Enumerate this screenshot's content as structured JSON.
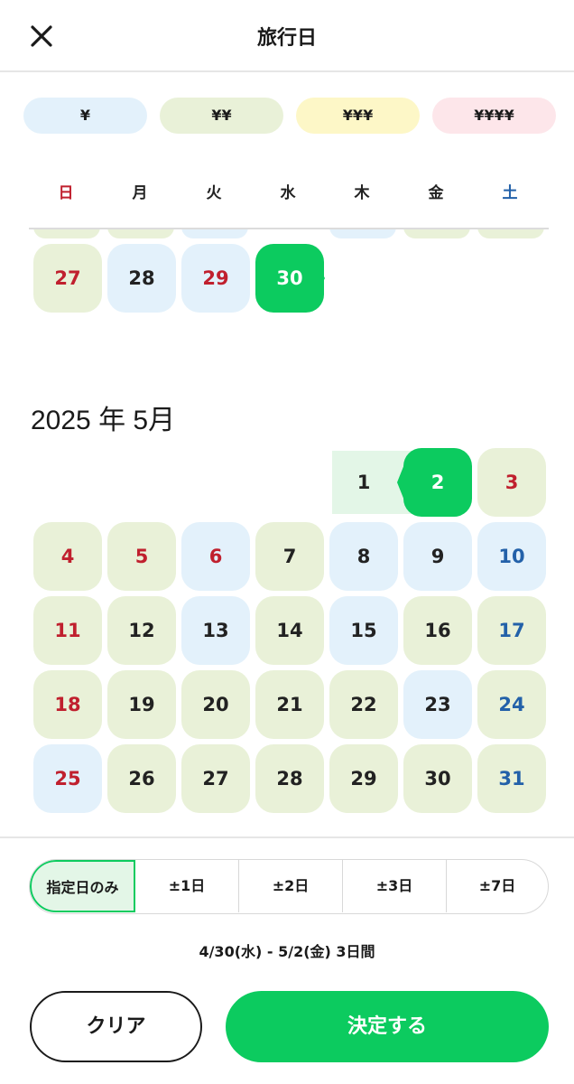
{
  "header": {
    "title": "旅行日",
    "close_icon": "close-icon"
  },
  "price_levels": [
    {
      "label": "¥",
      "color": "#e3f1fb"
    },
    {
      "label": "¥¥",
      "color": "#e9f1d8"
    },
    {
      "label": "¥¥¥",
      "color": "#fdf7c7"
    },
    {
      "label": "¥¥¥¥",
      "color": "#fde6ea"
    }
  ],
  "weekdays": [
    "日",
    "月",
    "火",
    "水",
    "木",
    "金",
    "土"
  ],
  "april_partial": {
    "days": [
      {
        "day": "27",
        "price": "green",
        "text": "red"
      },
      {
        "day": "28",
        "price": "blue",
        "text": "dark"
      },
      {
        "day": "29",
        "price": "blue",
        "text": "red"
      },
      {
        "day": "30",
        "price": "selected",
        "text": "white"
      }
    ]
  },
  "may": {
    "title": "2025 年 5月",
    "days": [
      {
        "day": "1",
        "price": "range",
        "text": "dark"
      },
      {
        "day": "2",
        "price": "selected",
        "text": "white"
      },
      {
        "day": "3",
        "price": "green",
        "text": "red"
      },
      {
        "day": "4",
        "price": "green",
        "text": "red"
      },
      {
        "day": "5",
        "price": "green",
        "text": "red"
      },
      {
        "day": "6",
        "price": "blue",
        "text": "red"
      },
      {
        "day": "7",
        "price": "green",
        "text": "dark"
      },
      {
        "day": "8",
        "price": "blue",
        "text": "dark"
      },
      {
        "day": "9",
        "price": "blue",
        "text": "dark"
      },
      {
        "day": "10",
        "price": "blue",
        "text": "blue"
      },
      {
        "day": "11",
        "price": "green",
        "text": "red"
      },
      {
        "day": "12",
        "price": "green",
        "text": "dark"
      },
      {
        "day": "13",
        "price": "blue",
        "text": "dark"
      },
      {
        "day": "14",
        "price": "green",
        "text": "dark"
      },
      {
        "day": "15",
        "price": "blue",
        "text": "dark"
      },
      {
        "day": "16",
        "price": "green",
        "text": "dark"
      },
      {
        "day": "17",
        "price": "green",
        "text": "blue"
      },
      {
        "day": "18",
        "price": "green",
        "text": "red"
      },
      {
        "day": "19",
        "price": "green",
        "text": "dark"
      },
      {
        "day": "20",
        "price": "green",
        "text": "dark"
      },
      {
        "day": "21",
        "price": "green",
        "text": "dark"
      },
      {
        "day": "22",
        "price": "green",
        "text": "dark"
      },
      {
        "day": "23",
        "price": "blue",
        "text": "dark"
      },
      {
        "day": "24",
        "price": "green",
        "text": "blue"
      },
      {
        "day": "25",
        "price": "blue",
        "text": "red"
      },
      {
        "day": "26",
        "price": "green",
        "text": "dark"
      },
      {
        "day": "27",
        "price": "green",
        "text": "dark"
      },
      {
        "day": "28",
        "price": "green",
        "text": "dark"
      },
      {
        "day": "29",
        "price": "green",
        "text": "dark"
      },
      {
        "day": "30",
        "price": "green",
        "text": "dark"
      },
      {
        "day": "31",
        "price": "green",
        "text": "blue"
      }
    ]
  },
  "range_options": [
    {
      "label": "指定日のみ",
      "active": true
    },
    {
      "label": "±1日",
      "active": false
    },
    {
      "label": "±2日",
      "active": false
    },
    {
      "label": "±3日",
      "active": false
    },
    {
      "label": "±7日",
      "active": false
    }
  ],
  "summary": "4/30(水) - 5/2(金) 3日間",
  "buttons": {
    "clear": "クリア",
    "confirm": "決定する"
  },
  "colors": {
    "accent": "#0ccb5f",
    "sunday_red": "#c0202e",
    "saturday_blue": "#2361a9",
    "range_fill": "#e3f6e7"
  }
}
